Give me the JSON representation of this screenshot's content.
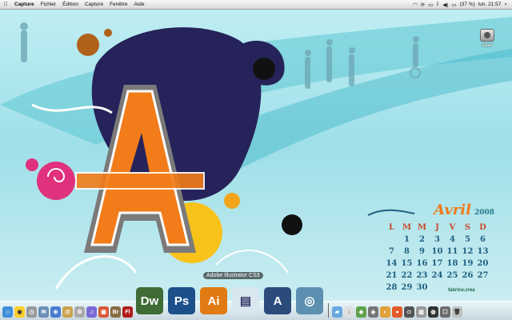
{
  "menubar": {
    "apple": "",
    "items": [
      "Capture",
      "Fichier",
      "Édition",
      "Capture",
      "Fenêtre",
      "Aide"
    ],
    "battery": "(37 %)",
    "clock": "lun. 21:57"
  },
  "desktop_icon": {
    "label": "Save"
  },
  "dock": {
    "tooltip": "Adobe Illustrator CS3",
    "big_apps": [
      {
        "name": "Dw",
        "color": "#3f6b35"
      },
      {
        "name": "Ps",
        "color": "#1d4f8a"
      },
      {
        "name": "Ai",
        "color": "#e07a12"
      }
    ],
    "small_apps": [
      "Br",
      "Fl"
    ]
  },
  "calendar": {
    "month": "Avril",
    "year": "2008",
    "weekdays": [
      "L",
      "M",
      "M",
      "J",
      "V",
      "S",
      "D"
    ],
    "days": [
      "",
      "1",
      "2",
      "3",
      "4",
      "5",
      "6",
      "7",
      "8",
      "9",
      "10",
      "11",
      "12",
      "13",
      "14",
      "15",
      "16",
      "17",
      "18",
      "19",
      "20",
      "21",
      "22",
      "23",
      "24",
      "25",
      "26",
      "27",
      "28",
      "29",
      "30",
      "",
      "",
      "",
      ""
    ],
    "signature": "fabrice.crea"
  }
}
